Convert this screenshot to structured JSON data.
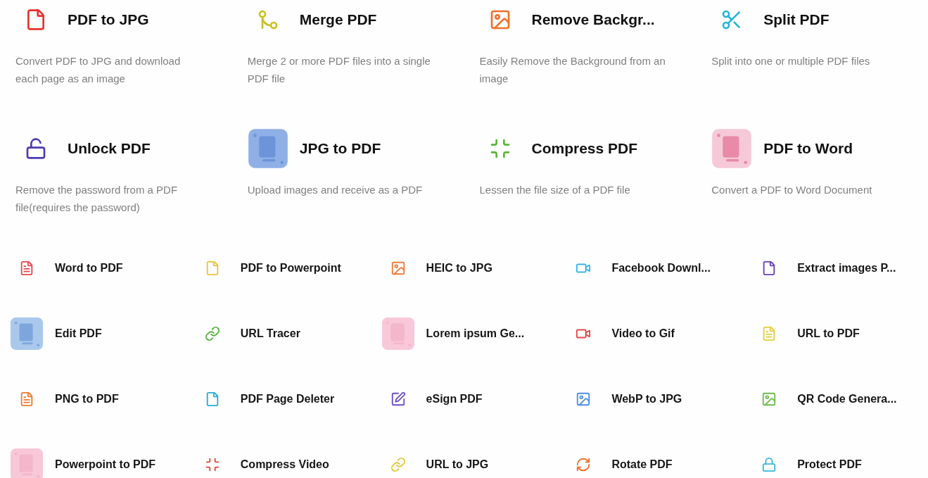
{
  "featured_tools": [
    {
      "title": "PDF to JPG",
      "description": "Convert PDF to JPG and download each page as an image",
      "kind": "icon",
      "color": "#e5322d"
    },
    {
      "title": "Merge PDF",
      "description": "Merge 2 or more PDF files into a single PDF file",
      "kind": "icon",
      "color": "#c9bf1f"
    },
    {
      "title": "Remove Backgr...",
      "description": "Easily Remove the Background from an image",
      "kind": "icon",
      "color": "#f0712c"
    },
    {
      "title": "Split PDF",
      "description": "Split into one or multiple PDF files",
      "kind": "icon",
      "color": "#27b3d6"
    },
    {
      "title": "Unlock PDF",
      "description": "Remove the password from a PDF file(requires the password)",
      "kind": "icon",
      "color": "#4b3bb4"
    },
    {
      "title": "JPG to PDF",
      "description": "Upload images and receive as a PDF",
      "kind": "picture"
    },
    {
      "title": "Compress PDF",
      "description": "Lessen the file size of a PDF file",
      "kind": "icon",
      "color": "#5db33a"
    },
    {
      "title": "PDF to Word",
      "description": "Convert a PDF to Word Document",
      "kind": "picture"
    }
  ],
  "tools": [
    {
      "label": "Word to PDF",
      "kind": "icon",
      "color": "#e5484d"
    },
    {
      "label": "PDF to Powerpoint",
      "kind": "icon",
      "color": "#e9c43a"
    },
    {
      "label": "HEIC to JPG",
      "kind": "icon",
      "color": "#f0793c"
    },
    {
      "label": "Facebook Downl...",
      "kind": "icon",
      "color": "#3ab6e0"
    },
    {
      "label": "Extract images P...",
      "kind": "icon",
      "color": "#6a3fb5"
    },
    {
      "label": "Edit PDF",
      "kind": "picture"
    },
    {
      "label": "URL Tracer",
      "kind": "icon",
      "color": "#55b33e"
    },
    {
      "label": "Lorem ipsum Ge...",
      "kind": "picture"
    },
    {
      "label": "Video to Gif",
      "kind": "icon",
      "color": "#e04848"
    },
    {
      "label": "URL to PDF",
      "kind": "icon",
      "color": "#e3cf36"
    },
    {
      "label": "PNG to PDF",
      "kind": "icon",
      "color": "#ef7a2c"
    },
    {
      "label": "PDF Page Deleter",
      "kind": "icon",
      "color": "#27aed0"
    },
    {
      "label": "eSign PDF",
      "kind": "icon",
      "color": "#6a4fc0"
    },
    {
      "label": "WebP to JPG",
      "kind": "icon",
      "color": "#4b8de0"
    },
    {
      "label": "QR Code Genera...",
      "kind": "icon",
      "color": "#6cbc4a"
    },
    {
      "label": "Powerpoint to PDF",
      "kind": "picture"
    },
    {
      "label": "Compress Video",
      "kind": "icon",
      "color": "#e5403a"
    },
    {
      "label": "URL to JPG",
      "kind": "icon",
      "color": "#e0c930"
    },
    {
      "label": "Rotate PDF",
      "kind": "icon",
      "color": "#f06a2a"
    },
    {
      "label": "Protect PDF",
      "kind": "icon",
      "color": "#3ab6e0"
    }
  ]
}
